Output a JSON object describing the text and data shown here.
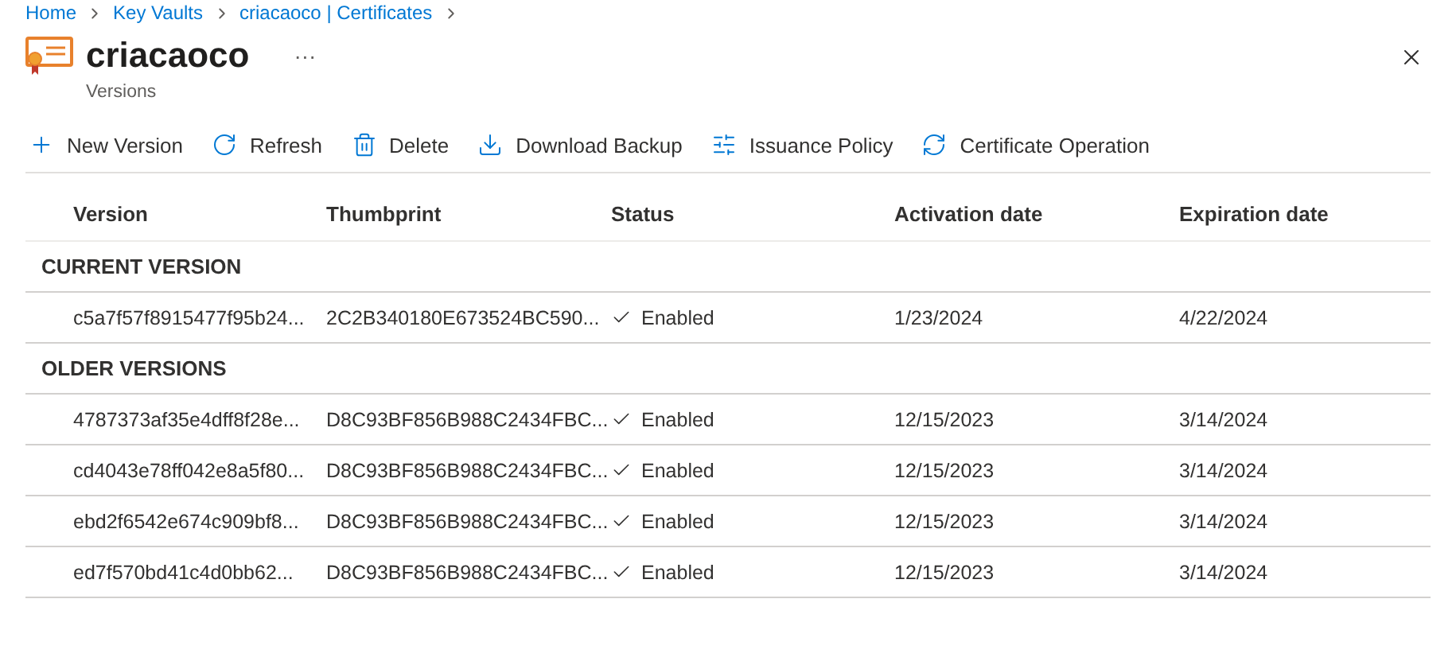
{
  "breadcrumb": [
    "Home",
    "Key Vaults",
    "criacaoco | Certificates"
  ],
  "header": {
    "title": "criacaoco",
    "more": "···",
    "subtitle": "Versions"
  },
  "toolbar": [
    {
      "label": "New Version",
      "kind": "plus"
    },
    {
      "label": "Refresh",
      "kind": "refresh"
    },
    {
      "label": "Delete",
      "kind": "delete"
    },
    {
      "label": "Download Backup",
      "kind": "download"
    },
    {
      "label": "Issuance Policy",
      "kind": "policy"
    },
    {
      "label": "Certificate Operation",
      "kind": "operation"
    }
  ],
  "table": {
    "columns": [
      "Version",
      "Thumbprint",
      "Status",
      "Activation date",
      "Expiration date"
    ],
    "groups": [
      {
        "label": "CURRENT VERSION",
        "rows": [
          {
            "version": "c5a7f57f8915477f95b24...",
            "thumbprint": "2C2B340180E673524BC590...",
            "status": "Enabled",
            "activation": "1/23/2024",
            "expiration": "4/22/2024"
          }
        ]
      },
      {
        "label": "OLDER VERSIONS",
        "rows": [
          {
            "version": "4787373af35e4dff8f28e...",
            "thumbprint": "D8C93BF856B988C2434FBC...",
            "status": "Enabled",
            "activation": "12/15/2023",
            "expiration": "3/14/2024"
          },
          {
            "version": "cd4043e78ff042e8a5f80...",
            "thumbprint": "D8C93BF856B988C2434FBC...",
            "status": "Enabled",
            "activation": "12/15/2023",
            "expiration": "3/14/2024"
          },
          {
            "version": "ebd2f6542e674c909bf8...",
            "thumbprint": "D8C93BF856B988C2434FBC...",
            "status": "Enabled",
            "activation": "12/15/2023",
            "expiration": "3/14/2024"
          },
          {
            "version": "ed7f570bd41c4d0bb62...",
            "thumbprint": "D8C93BF856B988C2434FBC...",
            "status": "Enabled",
            "activation": "12/15/2023",
            "expiration": "3/14/2024"
          }
        ]
      }
    ]
  }
}
